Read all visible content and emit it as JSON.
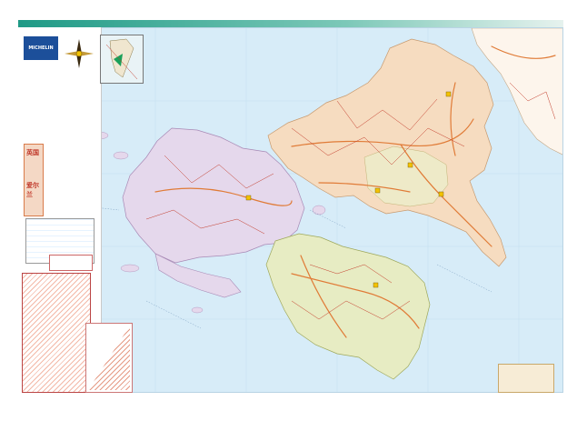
{
  "brand": "MICHELIN",
  "title_line_1": "英国",
  "title_line_2": "爱尔兰",
  "colors": {
    "sea": "#d7ecf8",
    "region_east": "#f6dcc0",
    "region_west": "#e5d8ec",
    "region_south": "#e7ecc3",
    "road_major": "#e07b37",
    "road_minor": "#c23b2a",
    "accent_bar": "#1f9a86"
  },
  "icons": [
    "compass-rose-icon",
    "michelin-logo-icon",
    "inset-map-icon",
    "distance-table-icon"
  ]
}
